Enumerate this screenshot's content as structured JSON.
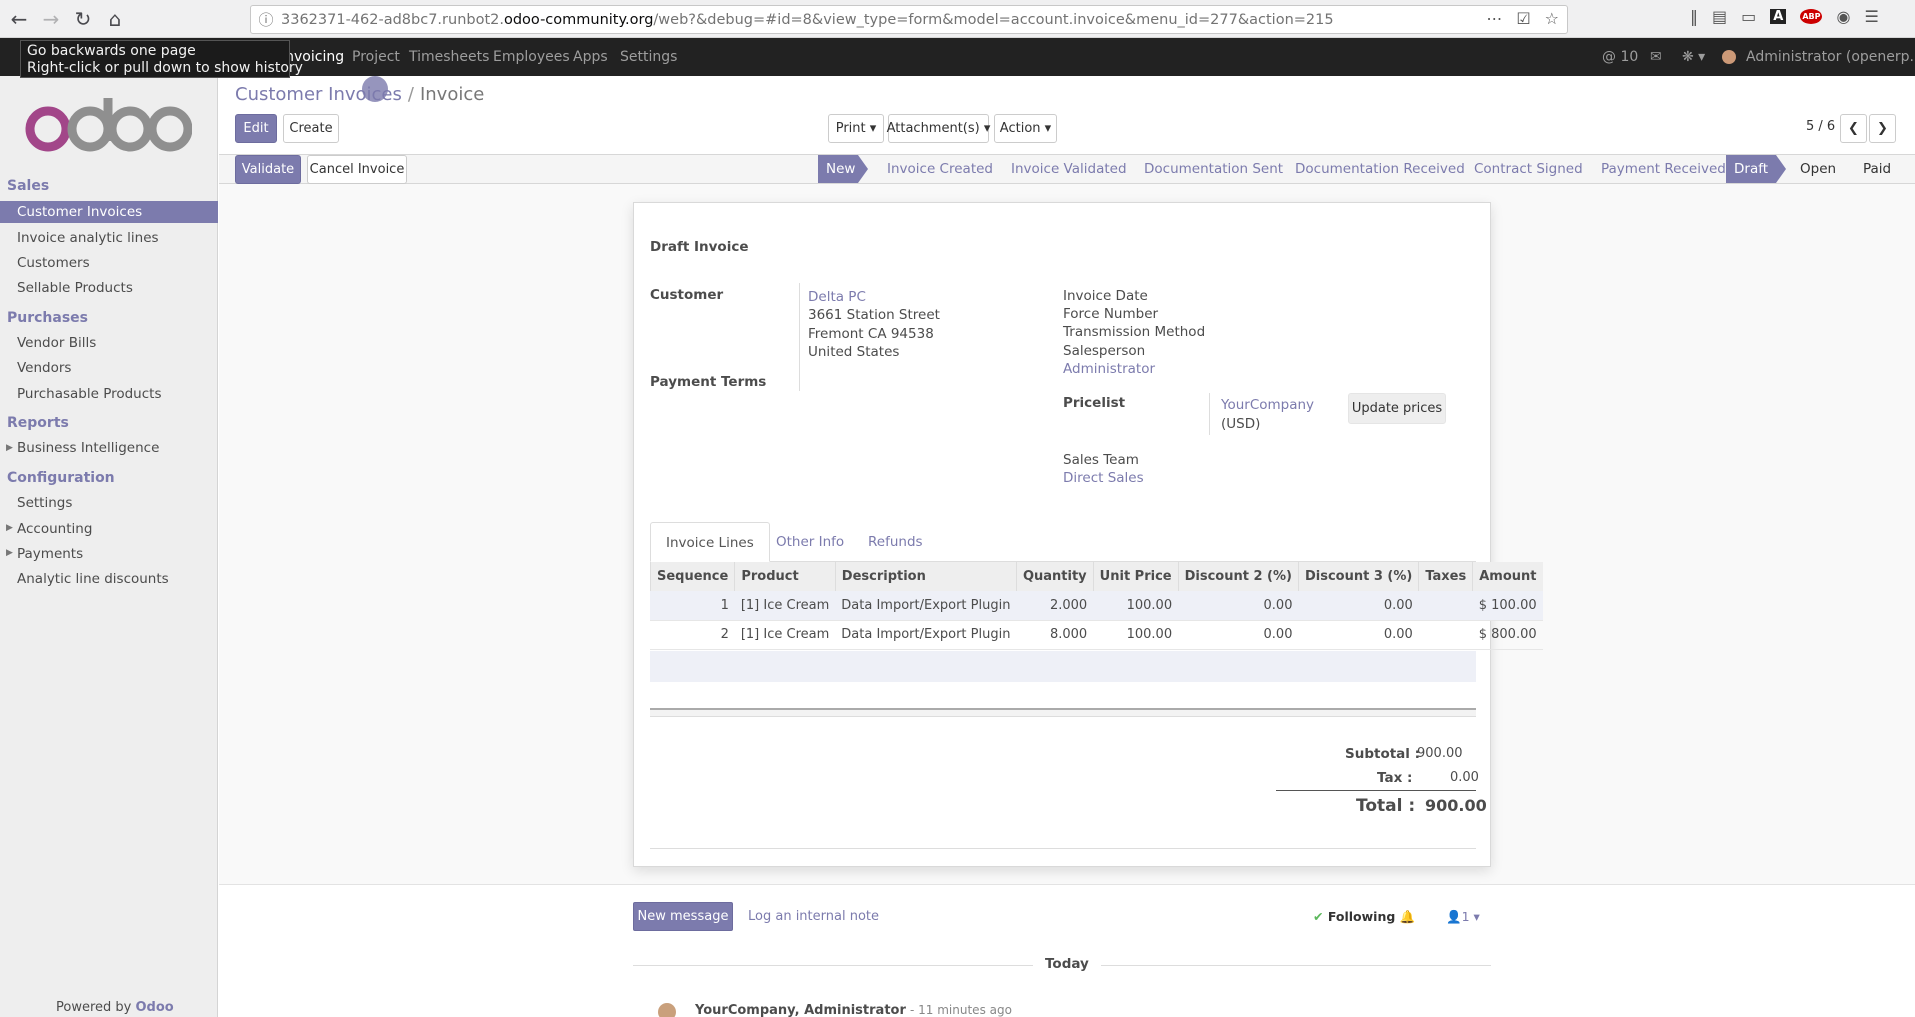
{
  "browser": {
    "url_host_prefix": "3362371-462-ad8bc7.runbot2.",
    "url_domain": "odoo-community.org",
    "url_path": "/web?&debug=#id=8&view_type=form&model=account.invoice&menu_id=277&action=215"
  },
  "tooltip": {
    "line1": "Go backwards one page",
    "line2": "Right-click or pull down to show history"
  },
  "topnav": {
    "items": [
      "Invoicing",
      "Project",
      "Timesheets",
      "Employees",
      "Apps",
      "Settings"
    ],
    "messages_count": "10",
    "user": "Administrator (openerp..."
  },
  "sidebar": {
    "sections": [
      {
        "title": "Sales",
        "items": [
          "Customer Invoices",
          "Invoice analytic lines",
          "Customers",
          "Sellable Products"
        ]
      },
      {
        "title": "Purchases",
        "items": [
          "Vendor Bills",
          "Vendors",
          "Purchasable Products"
        ]
      },
      {
        "title": "Reports",
        "items": [
          "Business Intelligence"
        ]
      },
      {
        "title": "Configuration",
        "items": [
          "Settings",
          "Accounting",
          "Payments",
          "Analytic line discounts"
        ]
      }
    ],
    "powered_prefix": "Powered by",
    "powered_brand": "Odoo"
  },
  "breadcrumb": {
    "parent": "Customer Invoices",
    "current": "Invoice"
  },
  "buttons": {
    "edit": "Edit",
    "create": "Create",
    "print": "Print",
    "attachments": "Attachment(s)",
    "action": "Action",
    "validate": "Validate",
    "cancel_invoice": "Cancel Invoice",
    "update_prices": "Update prices",
    "new_message": "New message",
    "log_note": "Log an internal note",
    "following": "Following",
    "followers": "1"
  },
  "pager": {
    "value": "5 / 6"
  },
  "stages": [
    "New",
    "Invoice Created",
    "Invoice Validated",
    "Documentation Sent",
    "Documentation Received",
    "Contract Signed",
    "Payment Received"
  ],
  "states": [
    "Draft",
    "Open",
    "Paid"
  ],
  "form": {
    "title": "Draft Invoice",
    "customer_label": "Customer",
    "customer_name": "Delta PC",
    "address1": "3661 Station Street",
    "address2": "Fremont CA 94538",
    "address3": "United States",
    "payment_terms_label": "Payment Terms",
    "invoice_date_label": "Invoice Date",
    "force_number_label": "Force Number",
    "transmission_label": "Transmission Method",
    "salesperson_label": "Salesperson",
    "salesperson": "Administrator",
    "pricelist_label": "Pricelist",
    "pricelist": "YourCompany",
    "pricelist_currency": "(USD)",
    "sales_team_label": "Sales Team",
    "sales_team": "Direct Sales"
  },
  "tabs": [
    "Invoice Lines",
    "Other Info",
    "Refunds"
  ],
  "lines": {
    "headers": [
      "Sequence",
      "Product",
      "Description",
      "Quantity",
      "Unit Price",
      "Discount 2 (%)",
      "Discount 3 (%)",
      "Taxes",
      "Amount"
    ],
    "rows": [
      [
        "1",
        "[1] Ice Cream",
        "Data Import/Export Plugin",
        "2.000",
        "100.00",
        "0.00",
        "0.00",
        "",
        "$ 100.00"
      ],
      [
        "2",
        "[1] Ice Cream",
        "Data Import/Export Plugin",
        "8.000",
        "100.00",
        "0.00",
        "0.00",
        "",
        "$ 800.00"
      ]
    ]
  },
  "totals": {
    "subtotal_label": "Subtotal :",
    "subtotal": "900.00",
    "tax_label": "Tax :",
    "tax": "0.00",
    "total_label": "Total :",
    "total": "900.00"
  },
  "chatter": {
    "today": "Today",
    "author": "YourCompany, Administrator",
    "time": "- 11 minutes ago"
  },
  "colors": {
    "brand": "#7c7bad",
    "topbar": "#222222"
  }
}
